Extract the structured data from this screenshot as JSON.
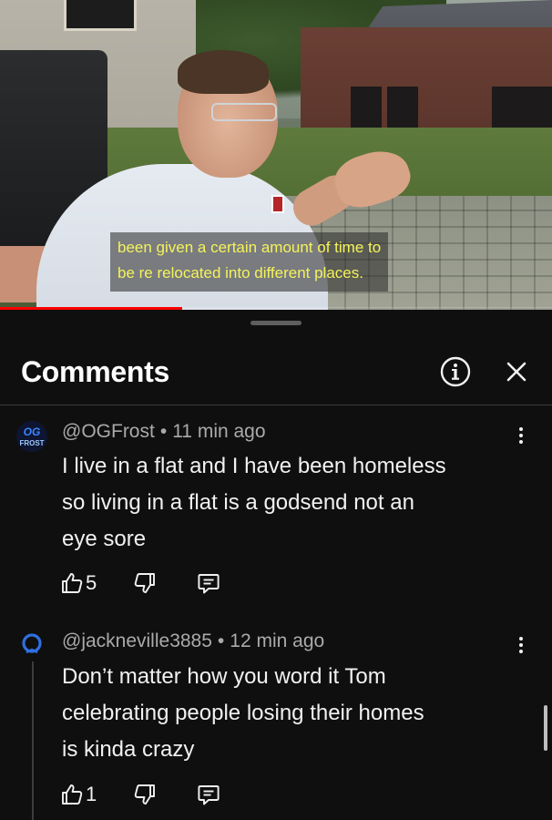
{
  "video": {
    "caption_line1": "been given a certain amount of time to",
    "caption_line2": "be re relocated into different places.",
    "progress": 0.33,
    "progress_color": "#ff0000",
    "caption_color": "#f5f35a"
  },
  "panel": {
    "title": "Comments",
    "info_icon": "info-icon",
    "close_icon": "close-icon"
  },
  "comments": [
    {
      "handle": "@OGFrost",
      "time": "11 min ago",
      "avatar_text_top": "OG",
      "avatar_text_bottom": "FROST",
      "text_line1": "I live in a flat and I have been homeless",
      "text_line2": "so living in a flat is a godsend not an",
      "text_line3": "eye sore",
      "likes": "5"
    },
    {
      "handle": "@jackneville3885",
      "time": "12 min ago",
      "text_line1": "Don’t matter how you word it Tom",
      "text_line2": "celebrating people losing their homes",
      "text_line3": "is kinda crazy",
      "likes": "1"
    }
  ],
  "colors": {
    "background": "#0f0f0f",
    "text_primary": "#f1f1f1",
    "text_secondary": "#aaaaaa",
    "accent_blue": "#2a63c9"
  }
}
